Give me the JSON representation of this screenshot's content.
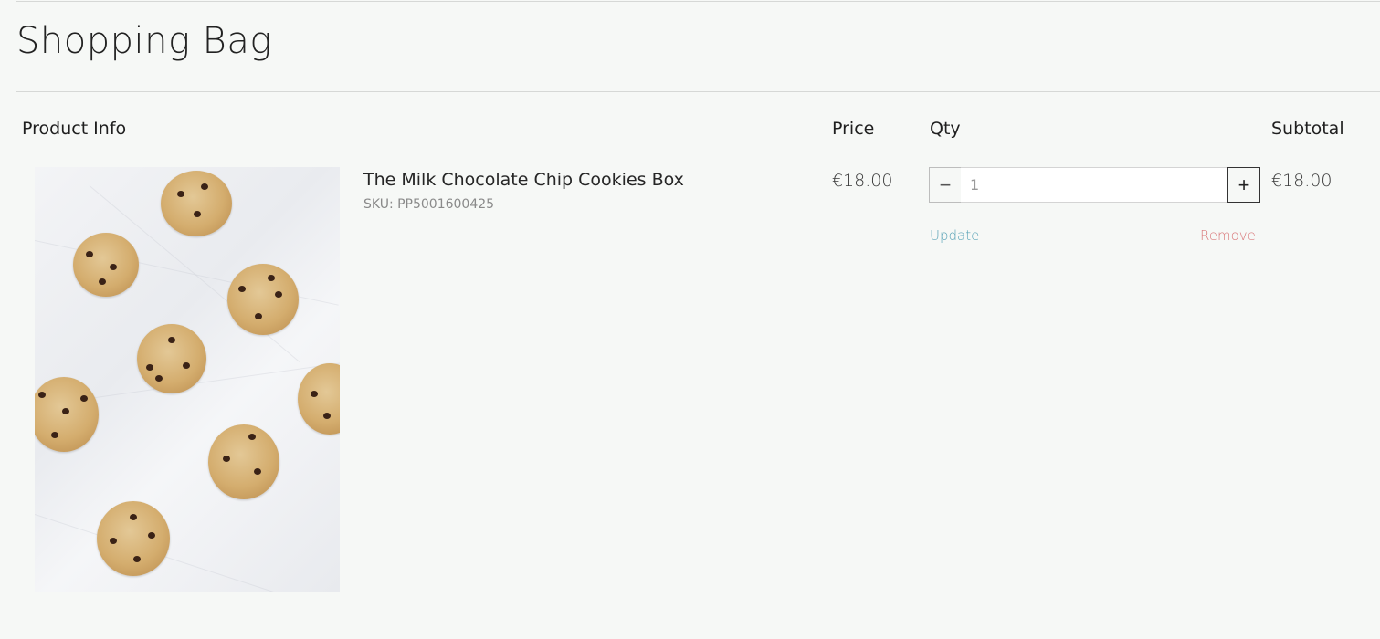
{
  "page": {
    "title": "Shopping Bag"
  },
  "table": {
    "headers": {
      "product": "Product Info",
      "price": "Price",
      "qty": "Qty",
      "subtotal": "Subtotal"
    }
  },
  "item": {
    "name": "The Milk Chocolate Chip Cookies Box",
    "sku": "SKU: PP5001600425",
    "price": "€18.00",
    "quantity": "1",
    "subtotal": "€18.00",
    "update_label": "Update",
    "remove_label": "Remove",
    "minus_symbol": "−",
    "plus_symbol": "+",
    "image_icon": "cookie-product-photo"
  },
  "colors": {
    "background": "#f6f8f6",
    "update_link": "#5aa3b7",
    "remove_link": "#d9787a"
  }
}
